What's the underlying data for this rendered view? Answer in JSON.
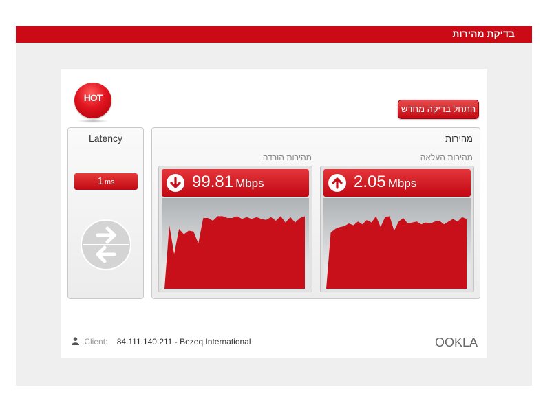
{
  "header": {
    "title": "בדיקת מהירות"
  },
  "logo": {
    "text": "HOT"
  },
  "start_button": {
    "label": "התחל בדיקה מחדש"
  },
  "latency": {
    "title": "Latency",
    "value": "1",
    "unit": "ms"
  },
  "speed": {
    "title": "מהירות",
    "upload": {
      "label": "מהירות העלאה",
      "value": "2.05",
      "unit": "Mbps",
      "icon": "arrow-up-icon",
      "history": [
        0.0,
        0.62,
        0.66,
        0.68,
        0.69,
        0.72,
        0.7,
        0.74,
        0.71,
        0.76,
        0.73,
        0.8,
        0.68,
        0.79,
        0.8,
        0.64,
        0.74,
        0.78,
        0.72,
        0.73,
        0.74,
        0.71,
        0.73,
        0.72,
        0.74,
        0.75,
        0.71,
        0.74,
        0.77,
        0.74,
        0.79,
        0.77
      ]
    },
    "download": {
      "label": "מהירות הורדה",
      "value": "99.81",
      "unit": "Mbps",
      "icon": "arrow-down-icon",
      "history": [
        0.0,
        0.7,
        0.38,
        0.66,
        0.6,
        0.64,
        0.63,
        0.5,
        0.78,
        0.78,
        0.75,
        0.8,
        0.8,
        0.78,
        0.78,
        0.8,
        0.77,
        0.79,
        0.77,
        0.79,
        0.77,
        0.76,
        0.79,
        0.75,
        0.8,
        0.73,
        0.79,
        0.73,
        0.78,
        0.8
      ]
    }
  },
  "client": {
    "label": "Client:",
    "value": "84.111.140.211 - Bezeq International"
  },
  "footer": {
    "brand": "OOKLA"
  },
  "colors": {
    "accent": "#cc0a16",
    "panel": "#ffffff",
    "frame": "#efefef"
  }
}
